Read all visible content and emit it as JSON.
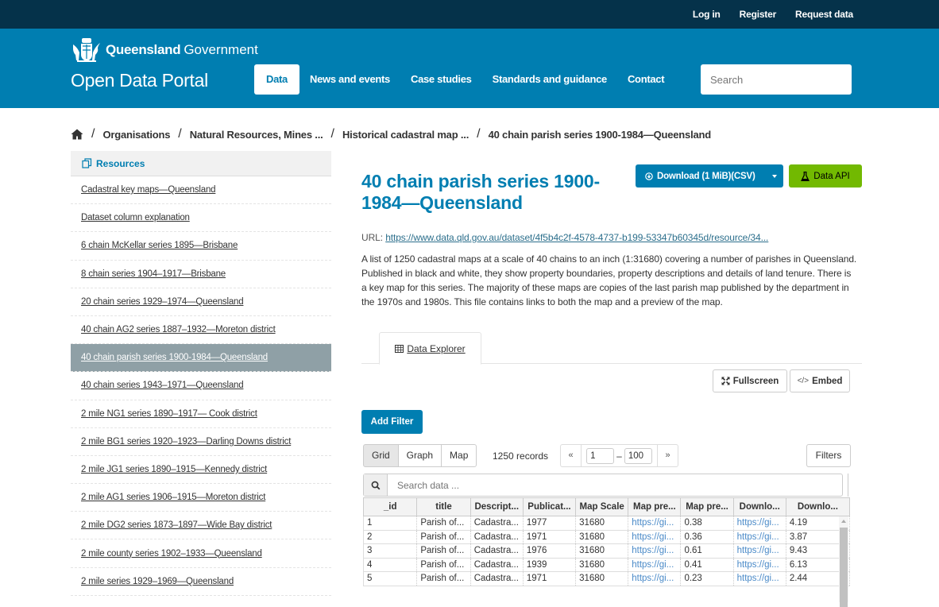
{
  "topbar": {
    "links": [
      "Log in",
      "Register",
      "Request data"
    ]
  },
  "header": {
    "brand_bold": "Queensland",
    "brand_regular": "Government",
    "portal_title": "Open Data Portal",
    "nav": [
      {
        "label": "Data",
        "active": true
      },
      {
        "label": "News and events",
        "active": false
      },
      {
        "label": "Case studies",
        "active": false
      },
      {
        "label": "Standards and guidance",
        "active": false
      },
      {
        "label": "Contact",
        "active": false
      }
    ],
    "search_placeholder": "Search"
  },
  "breadcrumb": {
    "home_icon": "home-icon",
    "items": [
      "Organisations",
      "Natural Resources, Mines ...",
      "Historical cadastral map ...",
      "40 chain parish series 1900-1984—Queensland"
    ]
  },
  "sidebar": {
    "heading": "Resources",
    "items": [
      {
        "label": "Cadastral key maps—Queensland",
        "active": false
      },
      {
        "label": "Dataset column explanation",
        "active": false
      },
      {
        "label": "6 chain McKellar series 1895—Brisbane",
        "active": false
      },
      {
        "label": "8 chain series 1904–1917—Brisbane",
        "active": false
      },
      {
        "label": "20 chain series 1929–1974—Queensland",
        "active": false
      },
      {
        "label": "40 chain AG2 series 1887–1932—Moreton district",
        "active": false
      },
      {
        "label": "40 chain parish series 1900-1984—Queensland",
        "active": true
      },
      {
        "label": "40 chain series 1943–1971—Queensland",
        "active": false
      },
      {
        "label": "2 mile NG1 series 1890–1917— Cook district",
        "active": false
      },
      {
        "label": "2 mile BG1 series 1920–1923—Darling Downs district",
        "active": false
      },
      {
        "label": "2 mile JG1 series 1890–1915—Kennedy district",
        "active": false
      },
      {
        "label": "2 mile AG1 series 1906–1915—Moreton district",
        "active": false
      },
      {
        "label": "2 mile DG2 series 1873–1897—Wide Bay district",
        "active": false
      },
      {
        "label": "2 mile county series 1902–1933—Queensland",
        "active": false
      },
      {
        "label": "2 mile series 1929–1969—Queensland",
        "active": false
      }
    ]
  },
  "resource": {
    "title": "40 chain parish series 1900-1984—Queensland",
    "download_label": "Download (1 MiB)(CSV)",
    "data_api_label": "Data API",
    "url_label": "URL:",
    "url": "https://www.data.qld.gov.au/dataset/4f5b4c2f-4578-4737-b199-53347b60345d/resource/34...",
    "description": "A list of 1250 cadastral maps at a scale of 40 chains to an inch (1:31680) covering a number of parishes in Queensland. Published in black and white, they show property boundaries, property descriptions and details of land tenure. There is a key map for this series. The majority of these maps are copies of the last parish map published by the department in the 1970s and 1980s. This file contains links to both the map and a preview of the map.",
    "tab_label": "Data Explorer",
    "fullscreen_label": "Fullscreen",
    "embed_label": "Embed",
    "add_filter_label": "Add Filter"
  },
  "explorer": {
    "views": [
      "Grid",
      "Graph",
      "Map"
    ],
    "active_view": "Grid",
    "record_count": "1250 records",
    "pager_prev": "«",
    "pager_next": "»",
    "page_from": "1",
    "page_to": "100",
    "filters_label": "Filters",
    "search_placeholder": "Search data ...",
    "columns": [
      "_id",
      "title",
      "Descript...",
      "Publicat...",
      "Map Scale",
      "Map pre...",
      "Map pre...",
      "Downlo...",
      "Downlo..."
    ],
    "rows": [
      [
        "1",
        "Parish of...",
        "Cadastra...",
        "1977",
        "31680",
        "https://gi...",
        "0.38",
        "https://gi...",
        "4.19"
      ],
      [
        "2",
        "Parish of...",
        "Cadastra...",
        "1971",
        "31680",
        "https://gi...",
        "0.36",
        "https://gi...",
        "3.87"
      ],
      [
        "3",
        "Parish of...",
        "Cadastra...",
        "1976",
        "31680",
        "https://gi...",
        "0.61",
        "https://gi...",
        "9.43"
      ],
      [
        "4",
        "Parish of...",
        "Cadastra...",
        "1939",
        "31680",
        "https://gi...",
        "0.41",
        "https://gi...",
        "6.13"
      ],
      [
        "5",
        "Parish of...",
        "Cadastra...",
        "1971",
        "31680",
        "https://gi...",
        "0.23",
        "https://gi...",
        "2.44"
      ]
    ]
  },
  "colors": {
    "topbar": "#05324a",
    "header": "#007eb1",
    "primary": "#007eb1",
    "api_green": "#72b901",
    "sidebar_active": "#8fa0a6"
  }
}
